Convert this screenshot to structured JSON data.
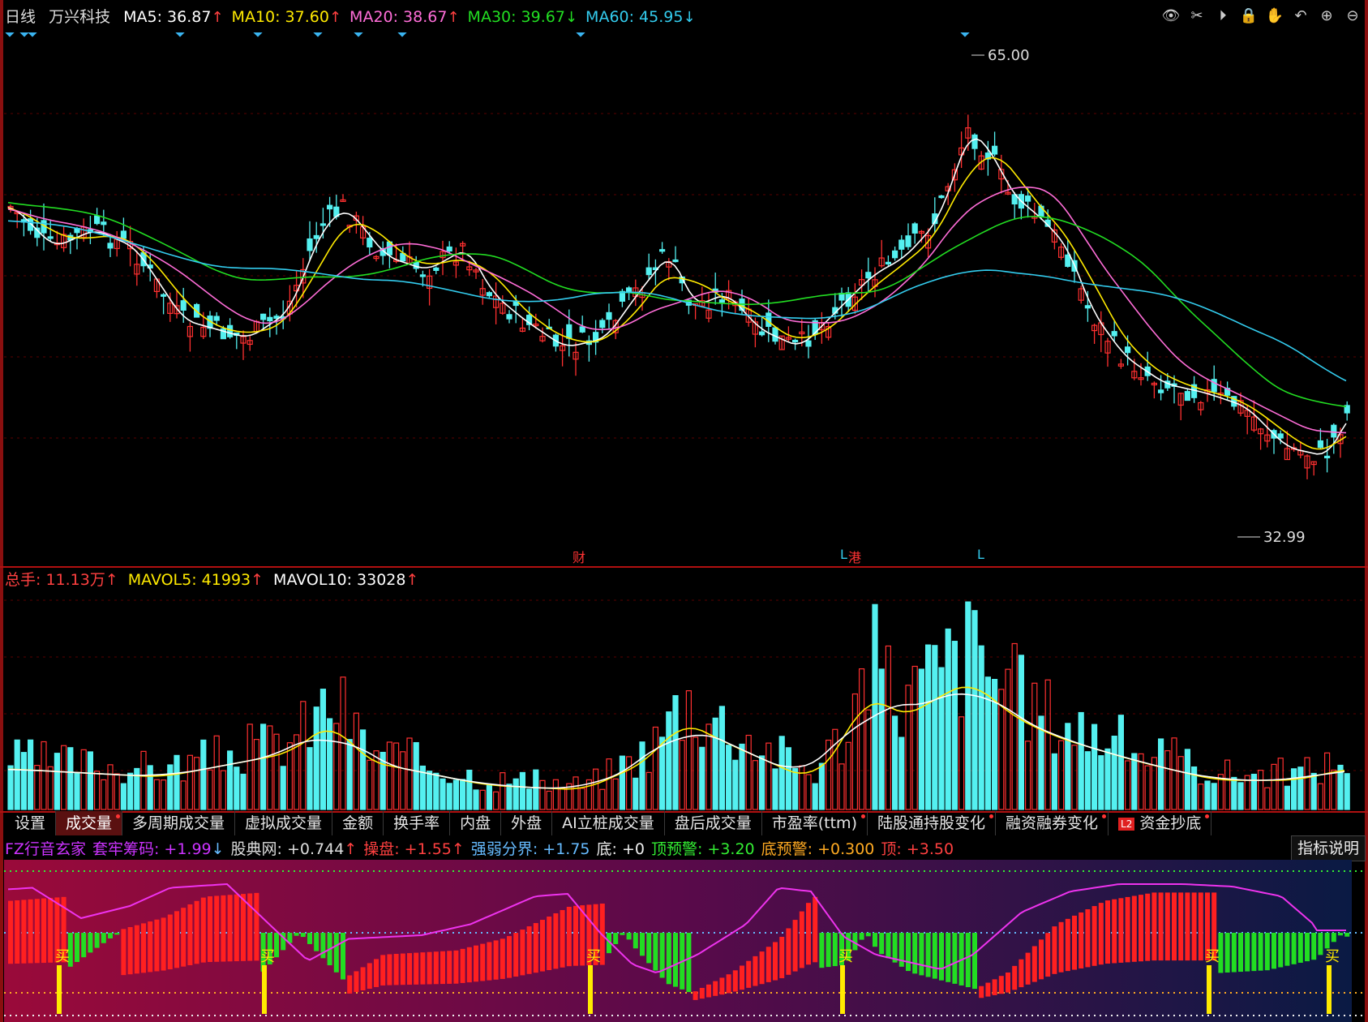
{
  "header": {
    "period": "日线",
    "stock_name": "万兴科技",
    "ma": [
      {
        "label": "MA5:",
        "value": "36.87",
        "arrow": "↑",
        "color": "#ffffff",
        "arrow_color": "#ff4040"
      },
      {
        "label": "MA10:",
        "value": "37.60",
        "arrow": "↑",
        "color": "#ffea00",
        "arrow_color": "#ff4040"
      },
      {
        "label": "MA20:",
        "value": "38.67",
        "arrow": "↑",
        "color": "#ff6dd8",
        "arrow_color": "#ff4040"
      },
      {
        "label": "MA30:",
        "value": "39.67",
        "arrow": "↓",
        "color": "#22dd22",
        "arrow_color": "#22dd22"
      },
      {
        "label": "MA60:",
        "value": "45.95",
        "arrow": "↓",
        "color": "#33ccee",
        "arrow_color": "#33ccee"
      }
    ],
    "toolbar_icons": [
      "eye-icon",
      "scissors-icon",
      "play-icon",
      "lock-icon",
      "hand-icon",
      "undo-icon",
      "zoom-in-icon",
      "zoom-out-icon"
    ]
  },
  "price_chart": {
    "high_label": "65.00",
    "low_label": "32.99",
    "markers": [
      {
        "text": "财",
        "color": "#ff3333"
      },
      {
        "text": "L",
        "color": "#33ccee"
      },
      {
        "text": "港",
        "color": "#ff3333"
      },
      {
        "text": "L",
        "color": "#33ccee"
      }
    ]
  },
  "volume_header": {
    "items": [
      {
        "text": "总手: 11.13万",
        "arrow": "↑",
        "color": "#ff4040"
      },
      {
        "text": "MAVOL5: 41993",
        "arrow": "↑",
        "color": "#ffea00"
      },
      {
        "text": "MAVOL10: 33028",
        "arrow": "↑",
        "color": "#ffffff"
      }
    ]
  },
  "tabs": [
    {
      "label": "设置",
      "dot": false,
      "active": false
    },
    {
      "label": "成交量",
      "dot": true,
      "active": true
    },
    {
      "label": "多周期成交量",
      "dot": false,
      "active": false
    },
    {
      "label": "虚拟成交量",
      "dot": false,
      "active": false
    },
    {
      "label": "金额",
      "dot": false,
      "active": false
    },
    {
      "label": "换手率",
      "dot": false,
      "active": false
    },
    {
      "label": "内盘",
      "dot": false,
      "active": false
    },
    {
      "label": "外盘",
      "dot": false,
      "active": false
    },
    {
      "label": "AI立桩成交量",
      "dot": false,
      "active": false
    },
    {
      "label": "盘后成交量",
      "dot": false,
      "active": false
    },
    {
      "label": "市盈率(ttm)",
      "dot": true,
      "active": false
    },
    {
      "label": "陆股通持股变化",
      "dot": true,
      "active": false
    },
    {
      "label": "融资融券变化",
      "dot": true,
      "active": false
    },
    {
      "label": "资金抄底",
      "dot": true,
      "active": false,
      "badge": "L2"
    }
  ],
  "indicator_header": {
    "items": [
      {
        "text": "FZ行音玄家",
        "color": "#cc33ff"
      },
      {
        "text": "套牢筹码: +1.99",
        "arrow": "↓",
        "color": "#cc33ff"
      },
      {
        "text": "股典网: +0.744",
        "arrow": "↑",
        "color": "#dddddd"
      },
      {
        "text": "操盘: +1.55",
        "arrow": "↑",
        "color": "#ff4040"
      },
      {
        "text": "强弱分界: +1.75",
        "arrow": "",
        "color": "#66bbff"
      },
      {
        "text": "底: +0",
        "arrow": "",
        "color": "#eeeeee"
      },
      {
        "text": "顶预警: +3.20",
        "arrow": "",
        "color": "#33ee33"
      },
      {
        "text": "底预警: +0.300",
        "arrow": "",
        "color": "#ffaa22"
      },
      {
        "text": "顶: +3.50",
        "arrow": "",
        "color": "#ff4040"
      }
    ],
    "explain_button": "指标说明",
    "buy_label": "买"
  }
}
